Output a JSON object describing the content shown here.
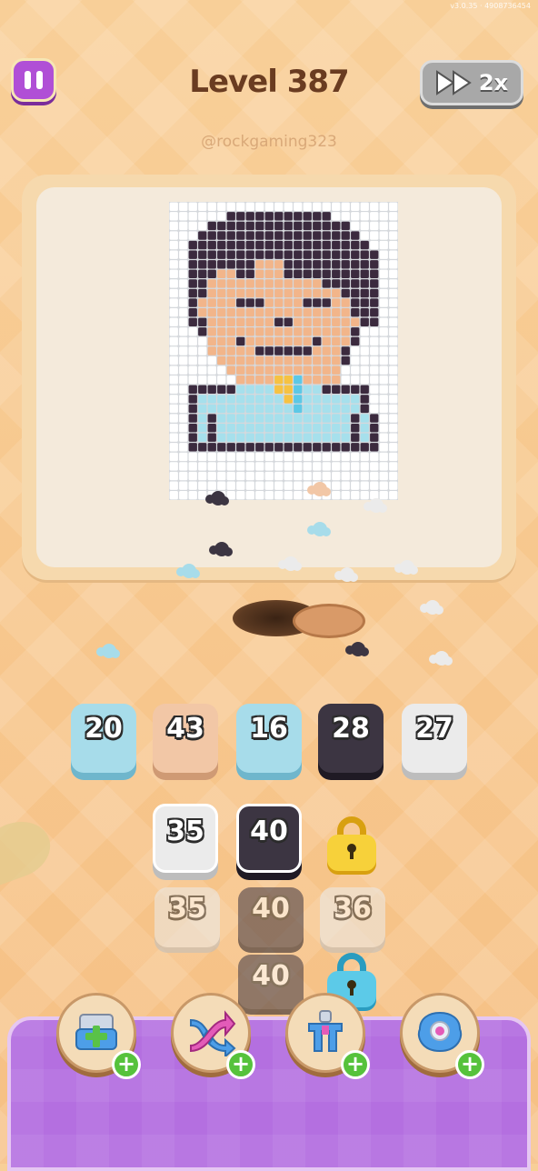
{
  "status_bar": {
    "version_text": "v3.0.35 · 4908736454"
  },
  "header": {
    "level_title": "Level 387",
    "speed_label": "2x",
    "username": "@rockgaming323"
  },
  "picture": {
    "cols": 24,
    "rows": 31,
    "palette": {
      ".": "#ffffff",
      "h": "#3b2a3e",
      "s": "#f2b58a",
      "b": "#a6e0ec",
      "y": "#f6c242",
      "c": "#5cc8e6",
      "w": "#dfe6ea"
    },
    "pixels": [
      "........................",
      "......hhhhhhhhhhh.......",
      "....hhhhhhhhhhhhhhh.....",
      "...hhhhhhhhhhhhhhhhh....",
      "..hhhhhhhhhhhhhhhhhhh...",
      "..hhhhhhhhhhhhhhhhhhhh..",
      "..hhhhhhhssshhhhhhhhhh..",
      "..hhhsshhssshhhhhhhhhh..",
      "..hhsssssssssssshhhhhh..",
      "..hhsssssssssssssshhhh..",
      "..hsssshhhsssshhhsshhh..",
      "..hsssssssssssssssshhh..",
      "..hhssssssshhssssssshh..",
      "...hsssssssssssssssh....",
      "....ssshssssssshsssh....",
      "....ssssshhhhhhsssh.....",
      ".....sssssssssssssh.....",
      "......ssssssssssss......",
      ".......ssssyycssss......",
      "..hhhhhbbbbyycbbhhhhh...",
      "..hbbbbbbbbbycbbbbbbh...",
      "..hbbbbbbbbbbcbbbbbbh...",
      "..hbhbbbbbbbbbbbbbbhbh..",
      "..hbhbbbbbbbbbbbbbbhbh..",
      "..hbhbbbbbbbbbbbbbbhbh..",
      "..hhhhhhhhhhhhhhhhhhhh..",
      "........................",
      "........................",
      "........................",
      "........................",
      "........................"
    ]
  },
  "color_stacks_top": [
    {
      "count": "20",
      "color": "#a7dcea",
      "shade": "#6fb6cc"
    },
    {
      "count": "43",
      "color": "#f2c7a6",
      "shade": "#cf9a74"
    },
    {
      "count": "16",
      "color": "#a7dcea",
      "shade": "#6fb6cc"
    },
    {
      "count": "28",
      "color": "#3c3542",
      "shade": "#1f1a24"
    },
    {
      "count": "27",
      "color": "#ebebeb",
      "shade": "#bdbdbd"
    }
  ],
  "queue": {
    "row1": [
      {
        "count": "35",
        "color": "#ebebeb",
        "shade": "#bdbdbd"
      },
      {
        "count": "40",
        "color": "#3c3542",
        "shade": "#1f1a24"
      }
    ],
    "row2": [
      {
        "count": "35",
        "color": "#ebebeb",
        "shade": "#bdbdbd"
      },
      {
        "count": "40",
        "color": "#3c3542",
        "shade": "#1f1a24"
      },
      {
        "count": "36",
        "color": "#ebebeb",
        "shade": "#bdbdbd"
      }
    ],
    "row3": [
      {
        "count": "40",
        "color": "#3c3542",
        "shade": "#1f1a24"
      }
    ],
    "locks": [
      {
        "icon": "yellow-lock-icon",
        "color": "#f7d13a",
        "shade": "#d8a010"
      },
      {
        "icon": "blue-lock-icon",
        "color": "#5ccae8",
        "shade": "#2a9cc0"
      }
    ]
  },
  "boosters": [
    {
      "icon": "add-tray-icon",
      "plus": "+"
    },
    {
      "icon": "shuffle-arrows-icon",
      "plus": "+"
    },
    {
      "icon": "magnet-claw-icon",
      "plus": "+"
    },
    {
      "icon": "blue-donut-icon",
      "plus": "+"
    }
  ]
}
